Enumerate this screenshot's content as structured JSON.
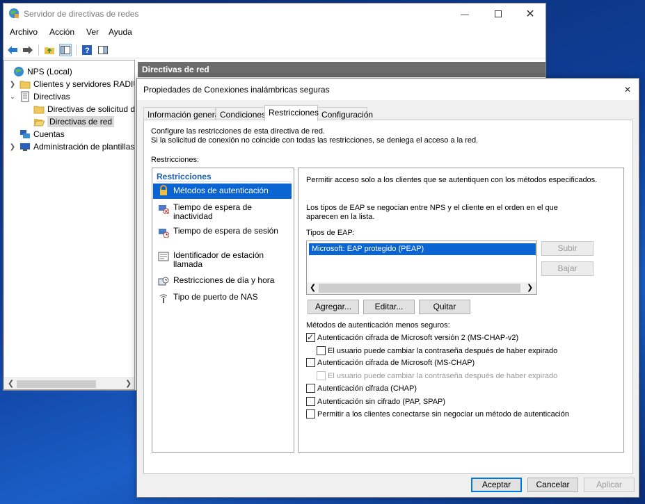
{
  "mmc": {
    "title": "Servidor de directivas de redes",
    "menu": [
      "Archivo",
      "Acción",
      "Ver",
      "Ayuda"
    ],
    "tree": [
      {
        "label": "NPS (Local)",
        "icon": "nps-icon"
      },
      {
        "label": "Clientes y servidores RADIUS",
        "icon": "folder-icon"
      },
      {
        "label": "Directivas",
        "icon": "policy-icon"
      },
      {
        "label": "Directivas de solicitud de conexión",
        "icon": "folder-icon"
      },
      {
        "label": "Directivas de red",
        "icon": "folder-open-icon"
      },
      {
        "label": "Cuentas",
        "icon": "accounts-icon"
      },
      {
        "label": "Administración de plantillas",
        "icon": "templates-icon"
      }
    ],
    "right_header": "Directivas de red"
  },
  "dialog": {
    "title": "Propiedades de Conexiones inalámbricas seguras",
    "tabs": [
      "Información general",
      "Condiciones",
      "Restricciones",
      "Configuración"
    ],
    "active_tab": "Restricciones",
    "intro_line1": "Configure las restricciones de esta directiva de red.",
    "intro_line2": "Si la solicitud de conexión no coincide con todas las restricciones, se deniega el acceso a la red.",
    "restrictions_label": "Restricciones:",
    "list_header": "Restricciones",
    "list_items": [
      {
        "label": "Métodos de autenticación",
        "icon": "lock-icon"
      },
      {
        "label": "Tiempo de espera de inactividad",
        "icon": "idle-timeout-icon"
      },
      {
        "label": "Tiempo de espera de sesión",
        "icon": "session-timeout-icon"
      },
      {
        "label": "Identificador de estación llamada",
        "icon": "station-id-icon"
      },
      {
        "label": "Restricciones de día y hora",
        "icon": "day-time-icon"
      },
      {
        "label": "Tipo de puerto de NAS",
        "icon": "nas-port-icon"
      }
    ],
    "right": {
      "text1": "Permitir acceso solo a los clientes que se autentiquen con los métodos especificados.",
      "text2": "Los tipos de EAP se negocian entre NPS y el cliente en el orden en el que aparecen en la lista.",
      "eap_label": "Tipos de EAP:",
      "eap_items": [
        "Microsoft: EAP protegido (PEAP)"
      ],
      "btn_up": "Subir",
      "btn_down": "Bajar",
      "btn_add": "Agregar...",
      "btn_edit": "Editar...",
      "btn_remove": "Quitar",
      "less_secure_label": "Métodos de autenticación menos seguros:",
      "checks": [
        {
          "label": "Autenticación cifrada de Microsoft versión 2 (MS-CHAP-v2)",
          "checked": true,
          "enabled": true
        },
        {
          "label": "El usuario puede cambiar la contraseña después de haber expirado",
          "checked": false,
          "enabled": true
        },
        {
          "label": "Autenticación cifrada de Microsoft (MS-CHAP)",
          "checked": false,
          "enabled": true
        },
        {
          "label": "El usuario puede cambiar la contraseña después de haber expirado",
          "checked": false,
          "enabled": false
        },
        {
          "label": "Autenticación cifrada (CHAP)",
          "checked": false,
          "enabled": true
        },
        {
          "label": "Autenticación sin cifrado (PAP, SPAP)",
          "checked": false,
          "enabled": true
        },
        {
          "label": "Permitir a los clientes conectarse sin negociar un método de autenticación",
          "checked": false,
          "enabled": true
        }
      ]
    },
    "footer": {
      "ok": "Aceptar",
      "cancel": "Cancelar",
      "apply": "Aplicar"
    }
  }
}
